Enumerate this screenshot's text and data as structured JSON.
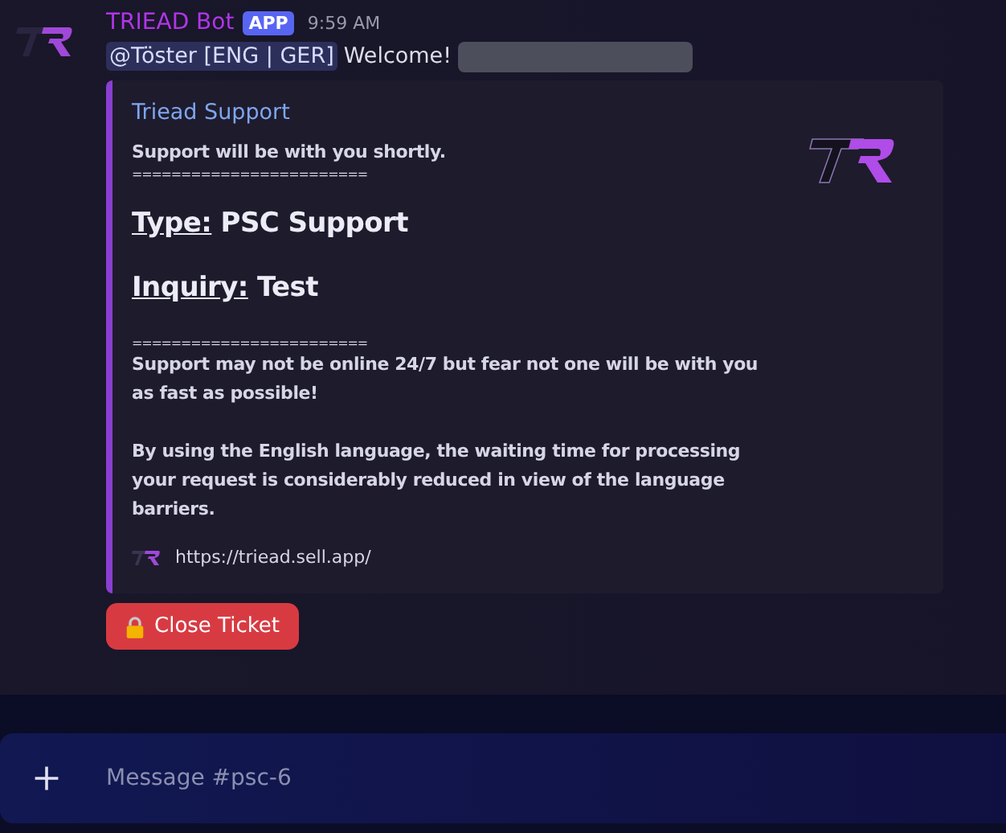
{
  "message": {
    "author": "TRIEAD Bot",
    "badge": "APP",
    "time": "9:59 AM",
    "mention": "@Töster [ENG | GER]",
    "text": "Welcome!"
  },
  "embed": {
    "title": "Triead Support",
    "intro": "Support will be with you shortly.",
    "divider": "========================",
    "fields": [
      {
        "label": "Type:",
        "value": "PSC Support"
      },
      {
        "label": "Inquiry:",
        "value": "Test"
      }
    ],
    "divider_2": "========================",
    "paragraphs": [
      "Support may not be online 24/7 but fear not one will be with you as fast as possible!",
      "By using the English language, the waiting time for processing your request is considerably reduced in view of the language barriers."
    ],
    "footer": "https://triead.sell.app/"
  },
  "button": {
    "label": "Close Ticket"
  },
  "composer": {
    "placeholder": "Message #psc-6"
  }
}
